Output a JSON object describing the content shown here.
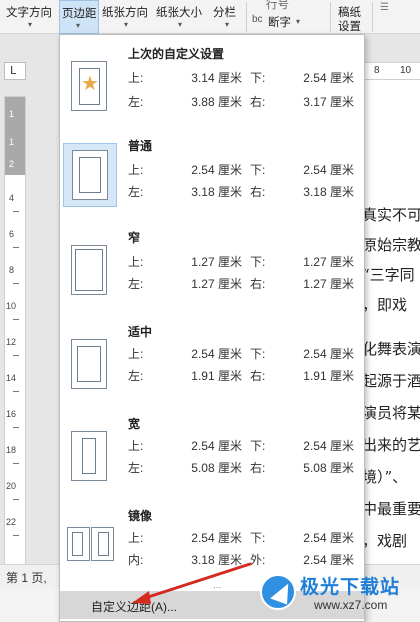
{
  "ribbon": {
    "text_direction": "文字方向",
    "margins": "页边距",
    "orientation": "纸张方向",
    "size": "纸张大小",
    "columns": "分栏",
    "line_numbers": "行号",
    "hyphenation": "断字",
    "manuscript_line1": "稿纸",
    "manuscript_line2": "设置",
    "arrow": "▾"
  },
  "ruler": {
    "corner": "L",
    "top_numbers": [
      "8",
      "10"
    ],
    "side_numbers": [
      "1",
      "1",
      "2",
      "4",
      "6",
      "8",
      "10",
      "12",
      "14",
      "16",
      "18",
      "20",
      "22"
    ]
  },
  "document": {
    "lines": [
      "真实不可",
      "原始宗教",
      "“三字同",
      "，即戏",
      "化舞表演",
      "起源于酒",
      "演员将某",
      "出来的艺",
      "境）”、",
      "中最重要",
      "，戏剧"
    ]
  },
  "statusbar": {
    "text": "第 1 页,"
  },
  "margins_menu": {
    "labels": {
      "top": "上:",
      "bottom": "下:",
      "left": "左:",
      "right": "右:",
      "inside": "内:",
      "outside": "外:"
    },
    "presets": [
      {
        "name": "上次的自定义设置",
        "top": "3.14 厘米",
        "bottom": "2.54 厘米",
        "left": "3.88 厘米",
        "right": "3.17 厘米"
      },
      {
        "name": "普通",
        "top": "2.54 厘米",
        "bottom": "2.54 厘米",
        "left": "3.18 厘米",
        "right": "3.18 厘米"
      },
      {
        "name": "窄",
        "top": "1.27 厘米",
        "bottom": "1.27 厘米",
        "left": "1.27 厘米",
        "right": "1.27 厘米"
      },
      {
        "name": "适中",
        "top": "2.54 厘米",
        "bottom": "2.54 厘米",
        "left": "1.91 厘米",
        "right": "1.91 厘米"
      },
      {
        "name": "宽",
        "top": "2.54 厘米",
        "bottom": "2.54 厘米",
        "left": "5.08 厘米",
        "right": "5.08 厘米"
      },
      {
        "name": "镜像",
        "top": "2.54 厘米",
        "bottom": "2.54 厘米",
        "inside": "3.18 厘米",
        "outside": "2.54 厘米"
      }
    ],
    "custom_label": "自定义边距(A)..."
  },
  "watermark": {
    "title": "极光下载站",
    "url": "www.xz7.com"
  },
  "colors": {
    "accent": "#cfe3f6",
    "arrow": "#d42a20",
    "watermark": "#1f7fd8",
    "star": "#e8a94a"
  }
}
